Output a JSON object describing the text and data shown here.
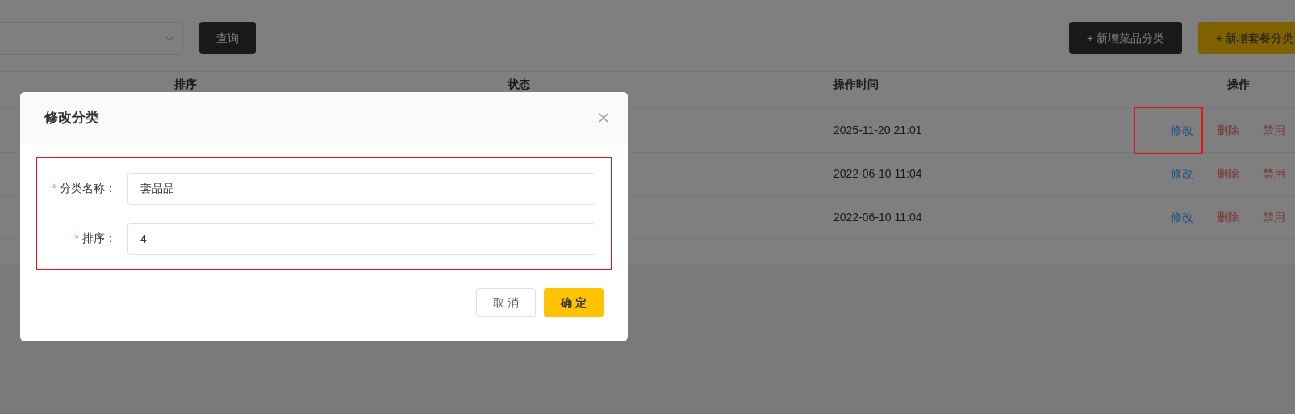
{
  "toolbar": {
    "query_button": "查询",
    "add_buttons": [
      {
        "label": "+ 新增菜品分类",
        "kind": "dark"
      },
      {
        "label": "+ 新增套餐分类",
        "kind": "accent"
      }
    ]
  },
  "table": {
    "columns": [
      "排序",
      "状态",
      "操作时间",
      "操作"
    ],
    "rows": [
      {
        "time": "2025-11-20 21:01",
        "actions": [
          {
            "label": "修改",
            "kind": "edit",
            "highlighted": true
          },
          {
            "label": "删除",
            "kind": "delete",
            "highlighted": false
          },
          {
            "label": "禁用",
            "kind": "disable",
            "highlighted": false
          }
        ]
      },
      {
        "time": "2022-06-10 11:04",
        "actions": [
          {
            "label": "修改",
            "kind": "edit",
            "highlighted": false
          },
          {
            "label": "删除",
            "kind": "delete",
            "highlighted": false
          },
          {
            "label": "禁用",
            "kind": "disable",
            "highlighted": false
          }
        ]
      },
      {
        "time": "2022-06-10 11:04",
        "actions": [
          {
            "label": "修改",
            "kind": "edit",
            "highlighted": false
          },
          {
            "label": "删除",
            "kind": "delete",
            "highlighted": false
          },
          {
            "label": "禁用",
            "kind": "disable",
            "highlighted": false
          }
        ]
      }
    ]
  },
  "dialog": {
    "title": "修改分类",
    "form_highlighted": true,
    "fields": [
      {
        "label": "分类名称：",
        "value": "套品品",
        "required_mark": "*"
      },
      {
        "label": "排序：",
        "value": "4",
        "required_mark": "*"
      }
    ],
    "buttons": [
      {
        "label": "取 消",
        "kind": "cancel"
      },
      {
        "label": "确 定",
        "kind": "confirm"
      }
    ]
  }
}
